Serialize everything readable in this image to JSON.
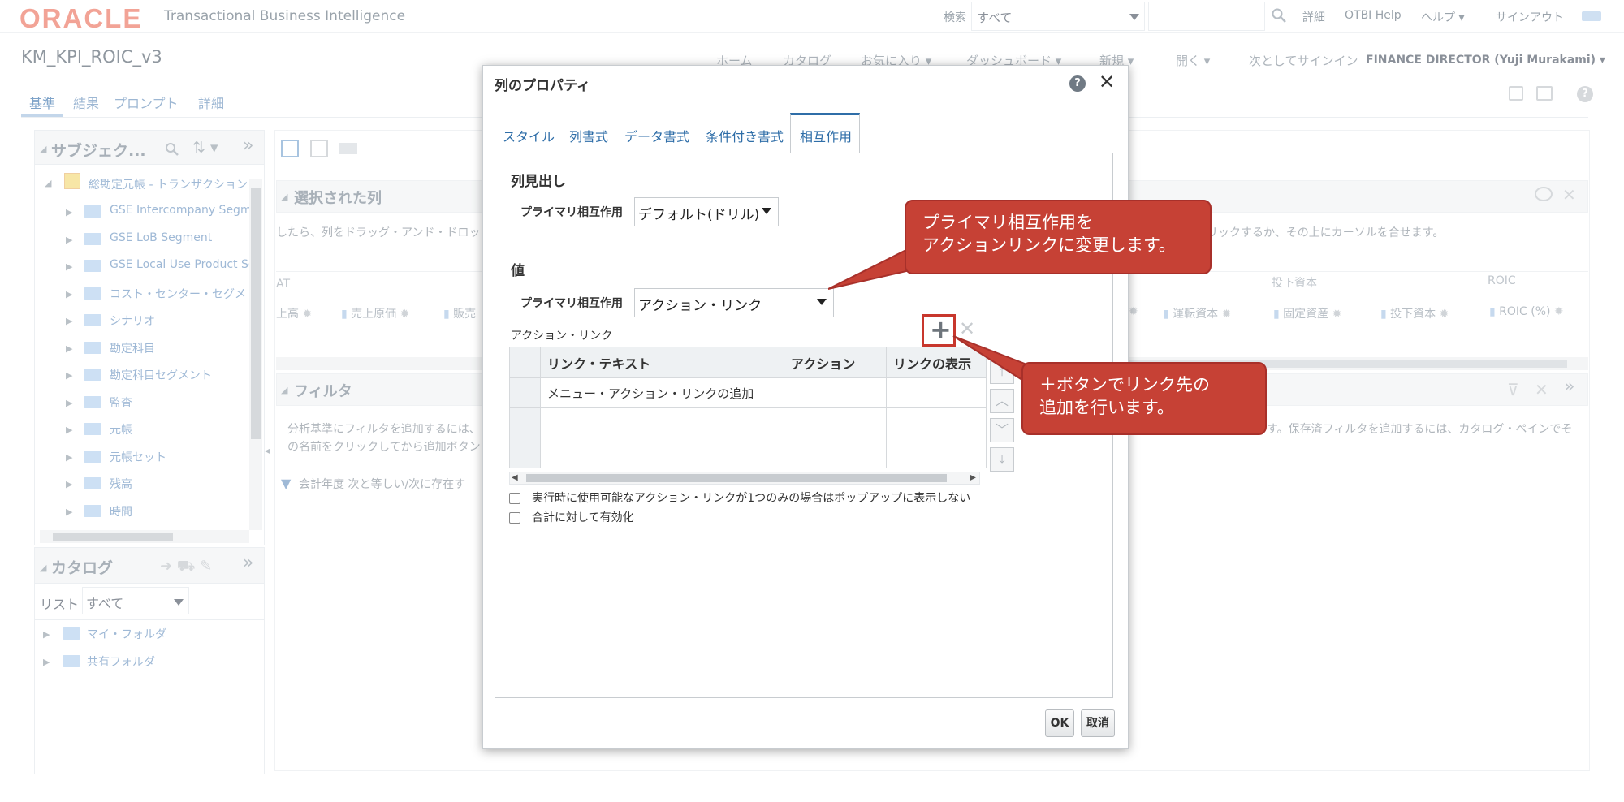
{
  "header": {
    "brand": "ORACLE",
    "product": "Transactional Business Intelligence",
    "search_label": "検索",
    "search_scope": "すべて",
    "search_input_value": "",
    "links": [
      "詳細",
      "OTBI Help",
      "ヘルプ ▾",
      "サインアウト"
    ]
  },
  "titlebar": {
    "page_title": "KM_KPI_ROIC_v3",
    "menu": [
      "ホーム",
      "カタログ",
      "お気に入り ▾",
      "ダッシュボード ▾",
      "新規 ▾",
      "開く ▾",
      "次としてサインイン"
    ],
    "signed_in_user": "FINANCE DIRECTOR (Yuji Murakami) ▾"
  },
  "editor_tabs": [
    "基準",
    "結果",
    "プロンプト",
    "詳細"
  ],
  "subject_panel": {
    "title": "サブジェク...",
    "root": "総勘定元帳 - トランザクション",
    "items": [
      "GSE Intercompany Segme",
      "GSE LoB Segment",
      "GSE Local Use Product Se",
      "コスト・センター・セグメ",
      "シナリオ",
      "勘定科目",
      "勘定科目セグメント",
      "監査",
      "元帳",
      "元帳セット",
      "残高",
      "時間"
    ]
  },
  "catalog_panel": {
    "title": "カタログ",
    "list_label": "リスト",
    "list_value": "すべて",
    "folders": [
      "マイ・フォルダ",
      "共有フォルダ"
    ]
  },
  "selected_columns": {
    "title": "選択された列",
    "hint_left": "したら、列をドラッグ・アンド・ドロッ",
    "hint_right": "リックするか、その上にカーソルを合せます。",
    "groups": [
      "AT",
      "投下資本",
      "ROIC"
    ],
    "columns_left": [
      "上高",
      "売上原価",
      "販売"
    ],
    "columns_right": [
      "運転資本",
      "固定資産",
      "投下資本",
      "ROIC (%)"
    ]
  },
  "filters": {
    "title": "フィルタ",
    "hint_left": "分析基準にフィルタを追加するには、",
    "hint_left2": "の名前をクリックしてから追加ボタン",
    "hint_right": "す。保存済フィルタを追加するには、カタログ・ペインでそ",
    "filter_item": "会計年度 次と等しい/次に存在す"
  },
  "dialog": {
    "title": "列のプロパティ",
    "help": "?",
    "close": "✕",
    "tabs": [
      "スタイル",
      "列書式",
      "データ書式",
      "条件付き書式",
      "相互作用"
    ],
    "active_tab": "相互作用",
    "heading_section": "列見出し",
    "heading_primary_label": "プライマリ相互作用",
    "heading_primary_value": "デフォルト(ドリル)",
    "value_section": "値",
    "value_primary_label": "プライマリ相互作用",
    "value_primary_value": "アクション・リンク",
    "action_links_label": "アクション・リンク",
    "table_headers": [
      "リンク・テキスト",
      "アクション",
      "リンクの表示"
    ],
    "table_rows": [
      [
        "メニュー・アクション・リンクの追加",
        "",
        ""
      ],
      [
        "",
        "",
        ""
      ],
      [
        "",
        "",
        ""
      ]
    ],
    "checkbox_single": "実行時に使用可能なアクション・リンクが1つのみの場合はポップアップに表示しない",
    "checkbox_totals": "合計に対して有効化",
    "ok": "OK",
    "cancel": "取消"
  },
  "callouts": {
    "primary_line1": "プライマリ相互作用を",
    "primary_line2": "アクションリンクに変更します。",
    "add_line1": "＋ボタンでリンク先の",
    "add_line2": "追加を行います。"
  },
  "colors": {
    "oracle_red": "#f2a396",
    "callout_red": "#c64135",
    "active_tab_blue": "#2f6ea8"
  }
}
